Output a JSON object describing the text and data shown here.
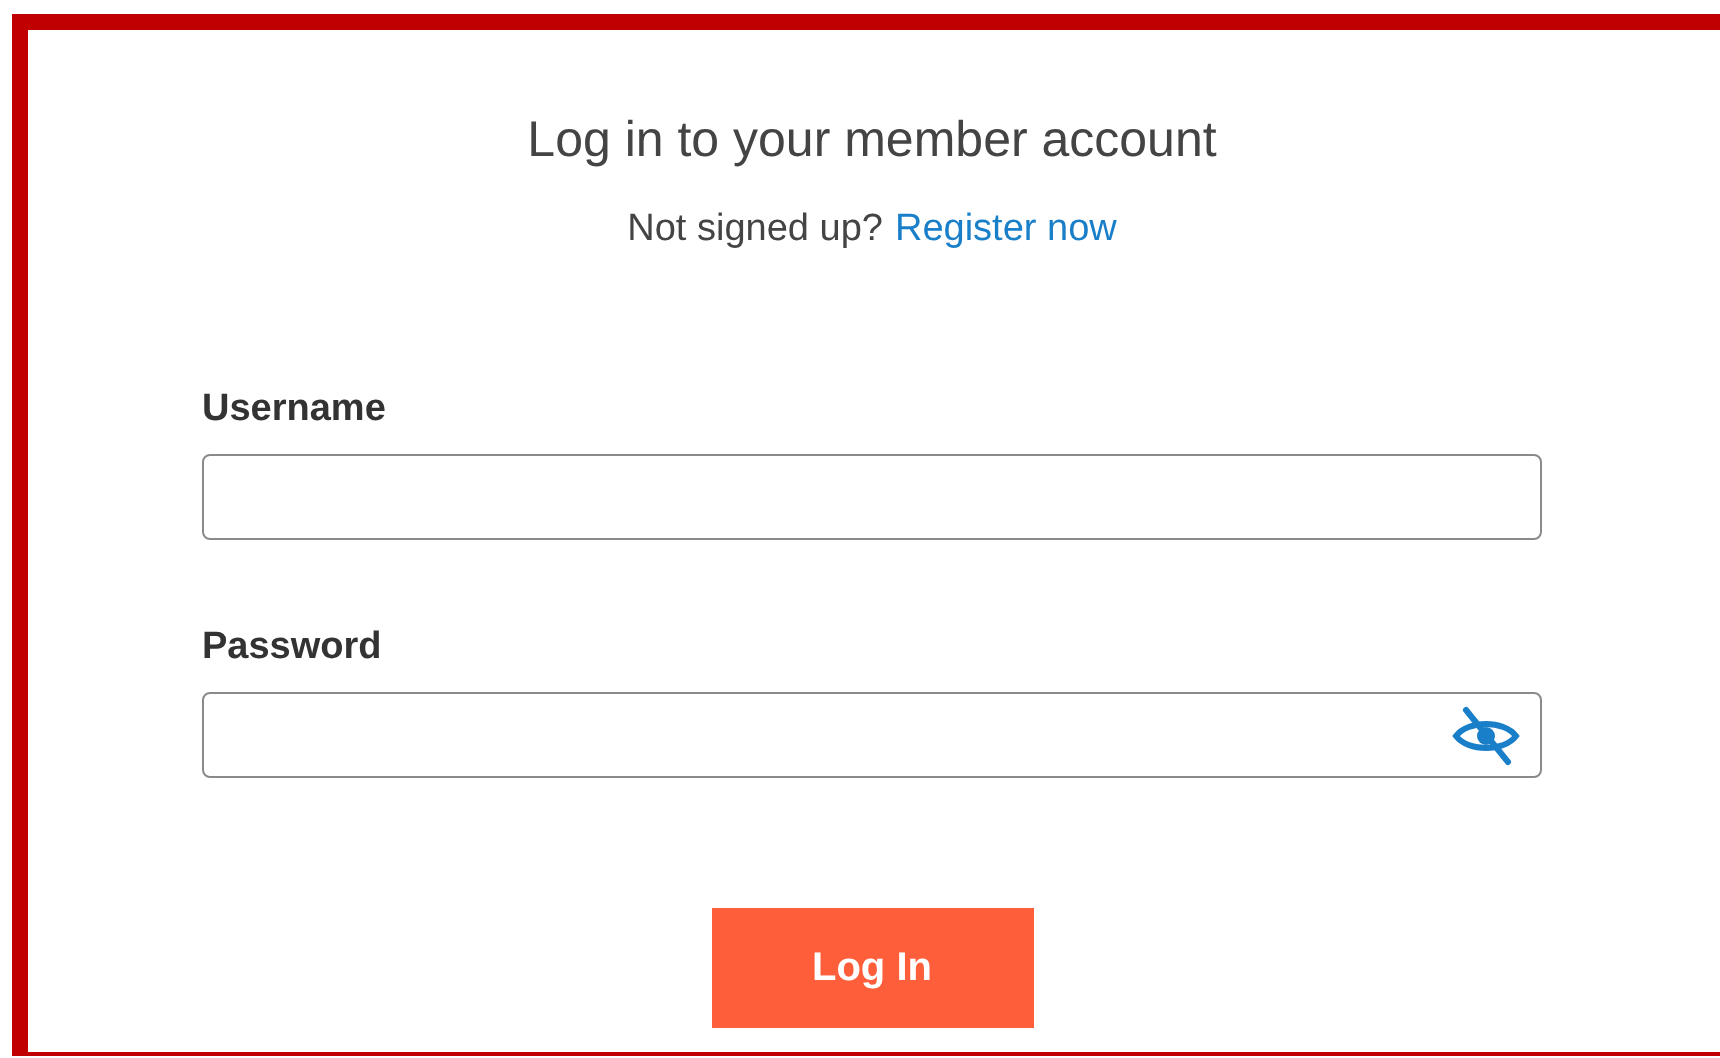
{
  "title": "Log in to your member account",
  "signup_prompt": {
    "text": "Not signed up?",
    "link": "Register now"
  },
  "fields": [
    {
      "label": "Username",
      "kind": "text"
    },
    {
      "label": "Password",
      "kind": "password"
    }
  ],
  "submit_button": "Log In"
}
